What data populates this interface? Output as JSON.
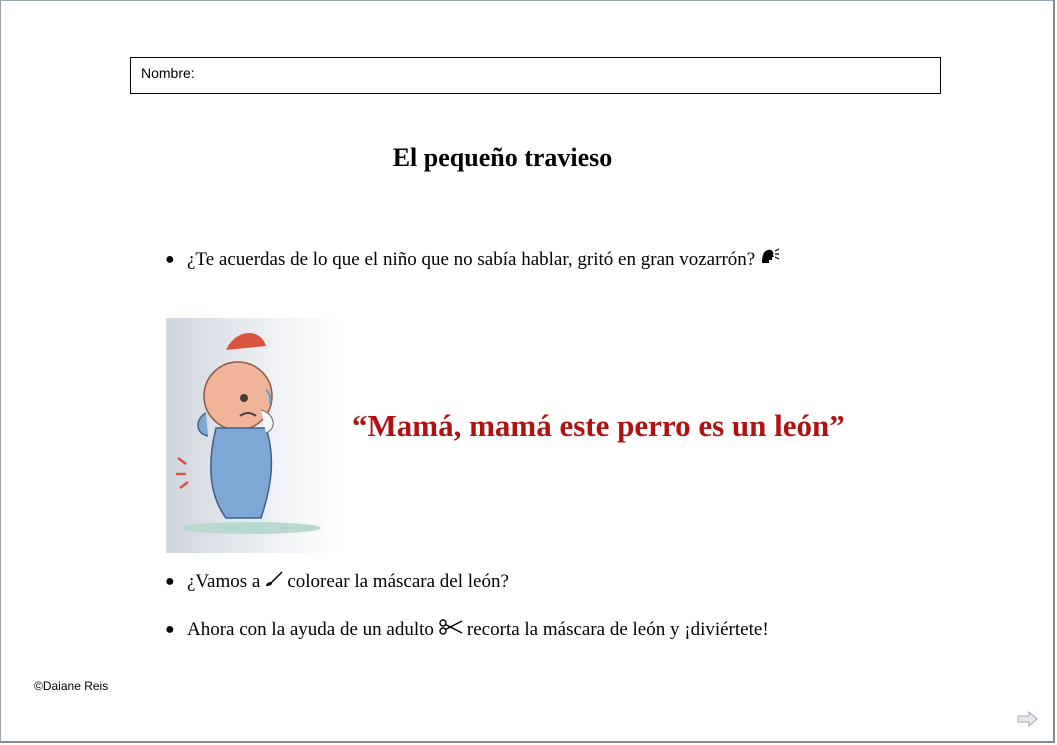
{
  "form": {
    "name_label": "Nombre:"
  },
  "title": "El pequeño travieso",
  "question1": {
    "text": "¿Te acuerdas de lo que el niño que no sabía hablar, gritó en gran vozarrón?",
    "icon": "speaking-head-icon"
  },
  "illustration": {
    "icon": "crying-child-illustration"
  },
  "quote": "“Mamá, mamá este perro es un león”",
  "colors": {
    "quote": "#b01212",
    "text": "#000000"
  },
  "question2": {
    "before": "¿Vamos a",
    "after": "colorear la máscara del león?",
    "icon": "brush-icon"
  },
  "question3": {
    "before": "Ahora con la ayuda de un adulto",
    "after": "recorta la máscara de león y ¡diviértete!",
    "icon": "scissors-icon"
  },
  "footer": {
    "copyright": "©Daiane Reis",
    "next_icon": "next-arrow-icon"
  }
}
